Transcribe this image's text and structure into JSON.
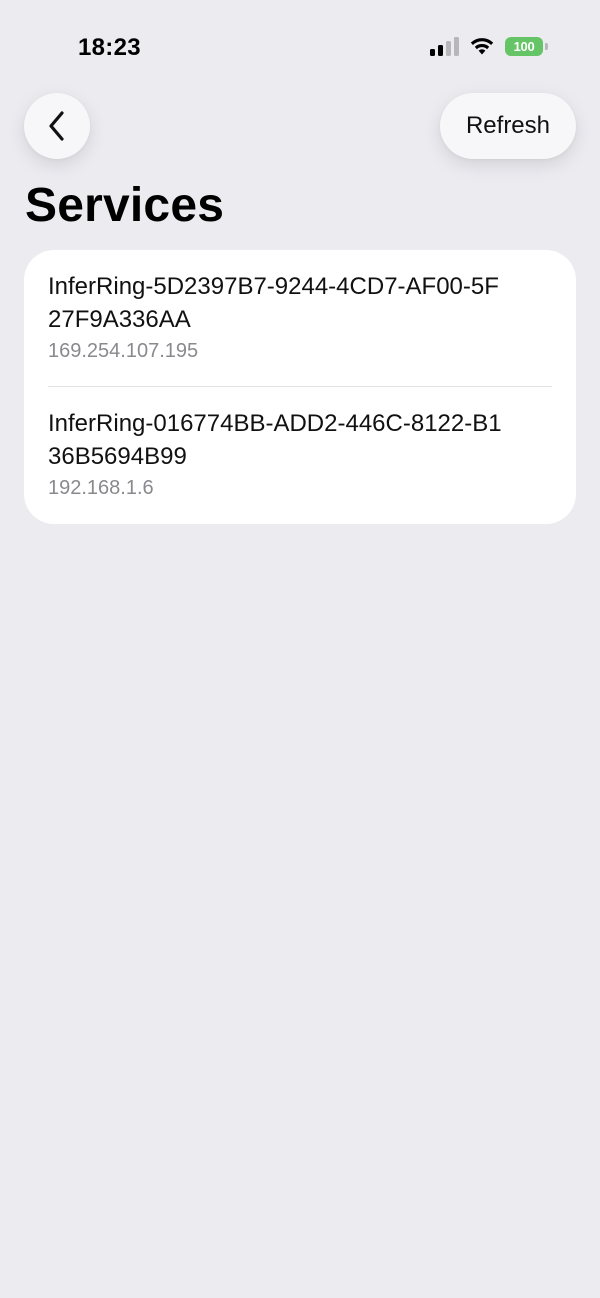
{
  "status_bar": {
    "time": "18:23",
    "battery_level": "100",
    "signal_bars_active": 2,
    "signal_bars_total": 4,
    "battery_color": "#65c466"
  },
  "nav": {
    "back_icon": "chevron-left-icon",
    "refresh_label": "Refresh"
  },
  "page": {
    "title": "Services"
  },
  "services": [
    {
      "name": "InferRing-5D2397B7-9244-4CD7-AF00-5F27F9A336AA",
      "ip": "169.254.107.195"
    },
    {
      "name": "InferRing-016774BB-ADD2-446C-8122-B136B5694B99",
      "ip": "192.168.1.6"
    }
  ],
  "colors": {
    "background": "#ebebf0",
    "card": "#ffffff",
    "secondary_text": "#8a8a8e"
  }
}
